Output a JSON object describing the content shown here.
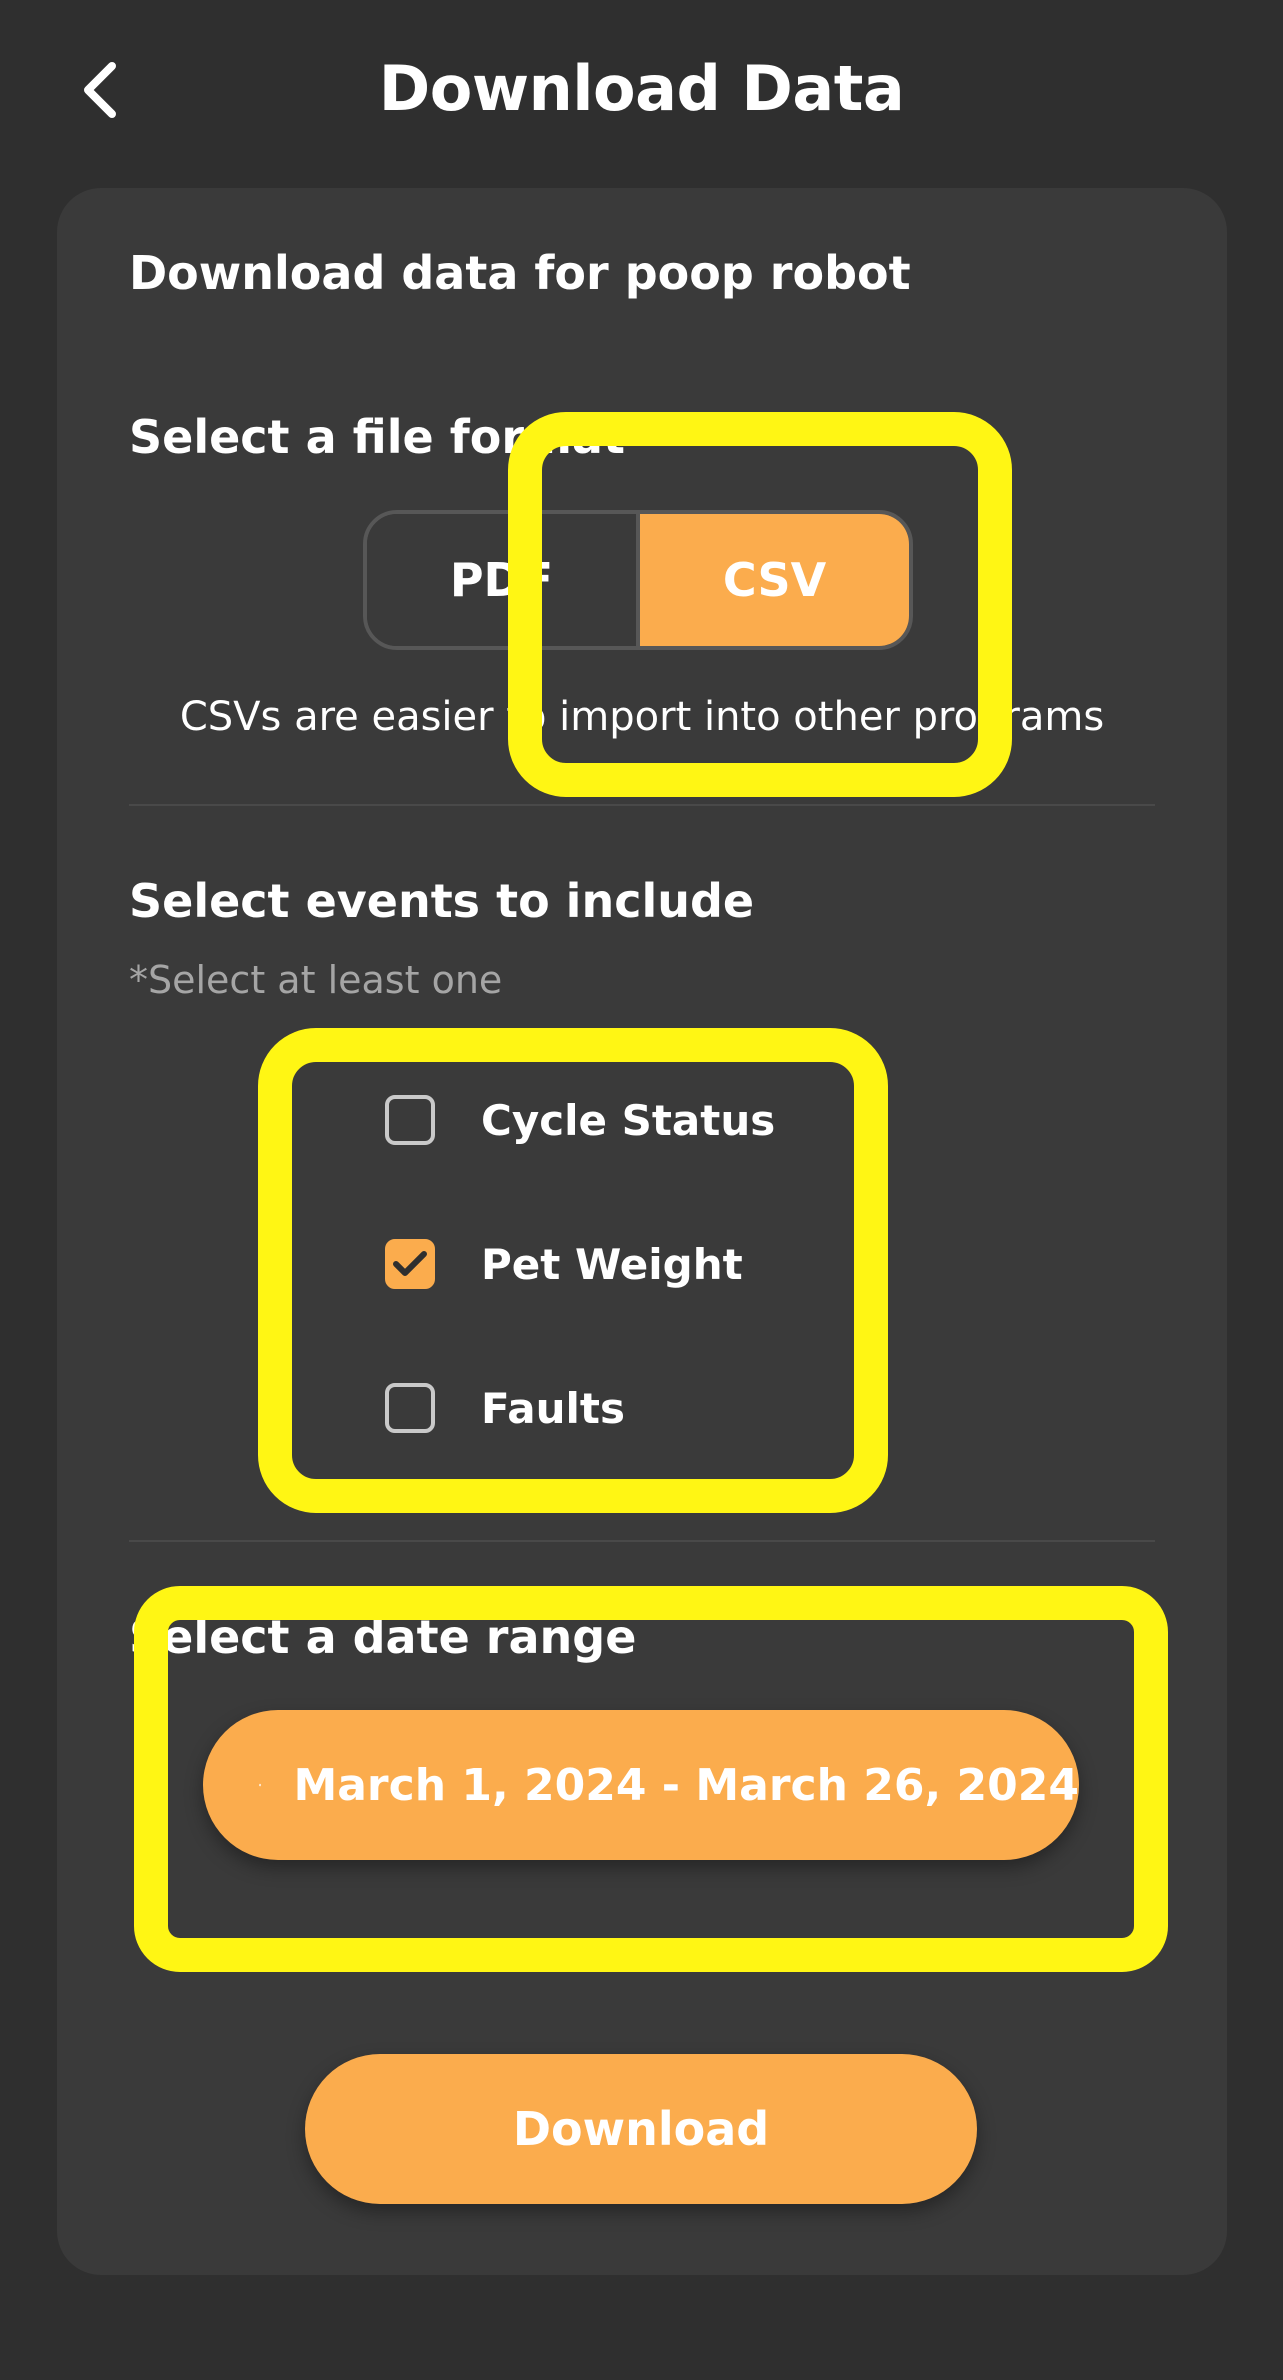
{
  "header": {
    "title": "Download Data",
    "back_icon": "chevron-left-icon"
  },
  "card": {
    "title": "Download data for poop robot"
  },
  "file_format": {
    "label": "Select a file format",
    "options": [
      "PDF",
      "CSV"
    ],
    "selected": "CSV",
    "helper": "CSVs are easier to import into other programs"
  },
  "events": {
    "label": "Select events to include",
    "note": "*Select at least one",
    "items": [
      {
        "label": "Cycle Status",
        "checked": false
      },
      {
        "label": "Pet Weight",
        "checked": true
      },
      {
        "label": "Faults",
        "checked": false
      }
    ]
  },
  "date_range": {
    "label": "Select a date range",
    "value": "March 1, 2024 - March 26, 2024",
    "icon": "calendar-icon"
  },
  "download": {
    "label": "Download"
  },
  "colors": {
    "background": "#2f2f2f",
    "card": "#3a3a3a",
    "accent": "#fbac4d",
    "highlight": "#fff614"
  }
}
